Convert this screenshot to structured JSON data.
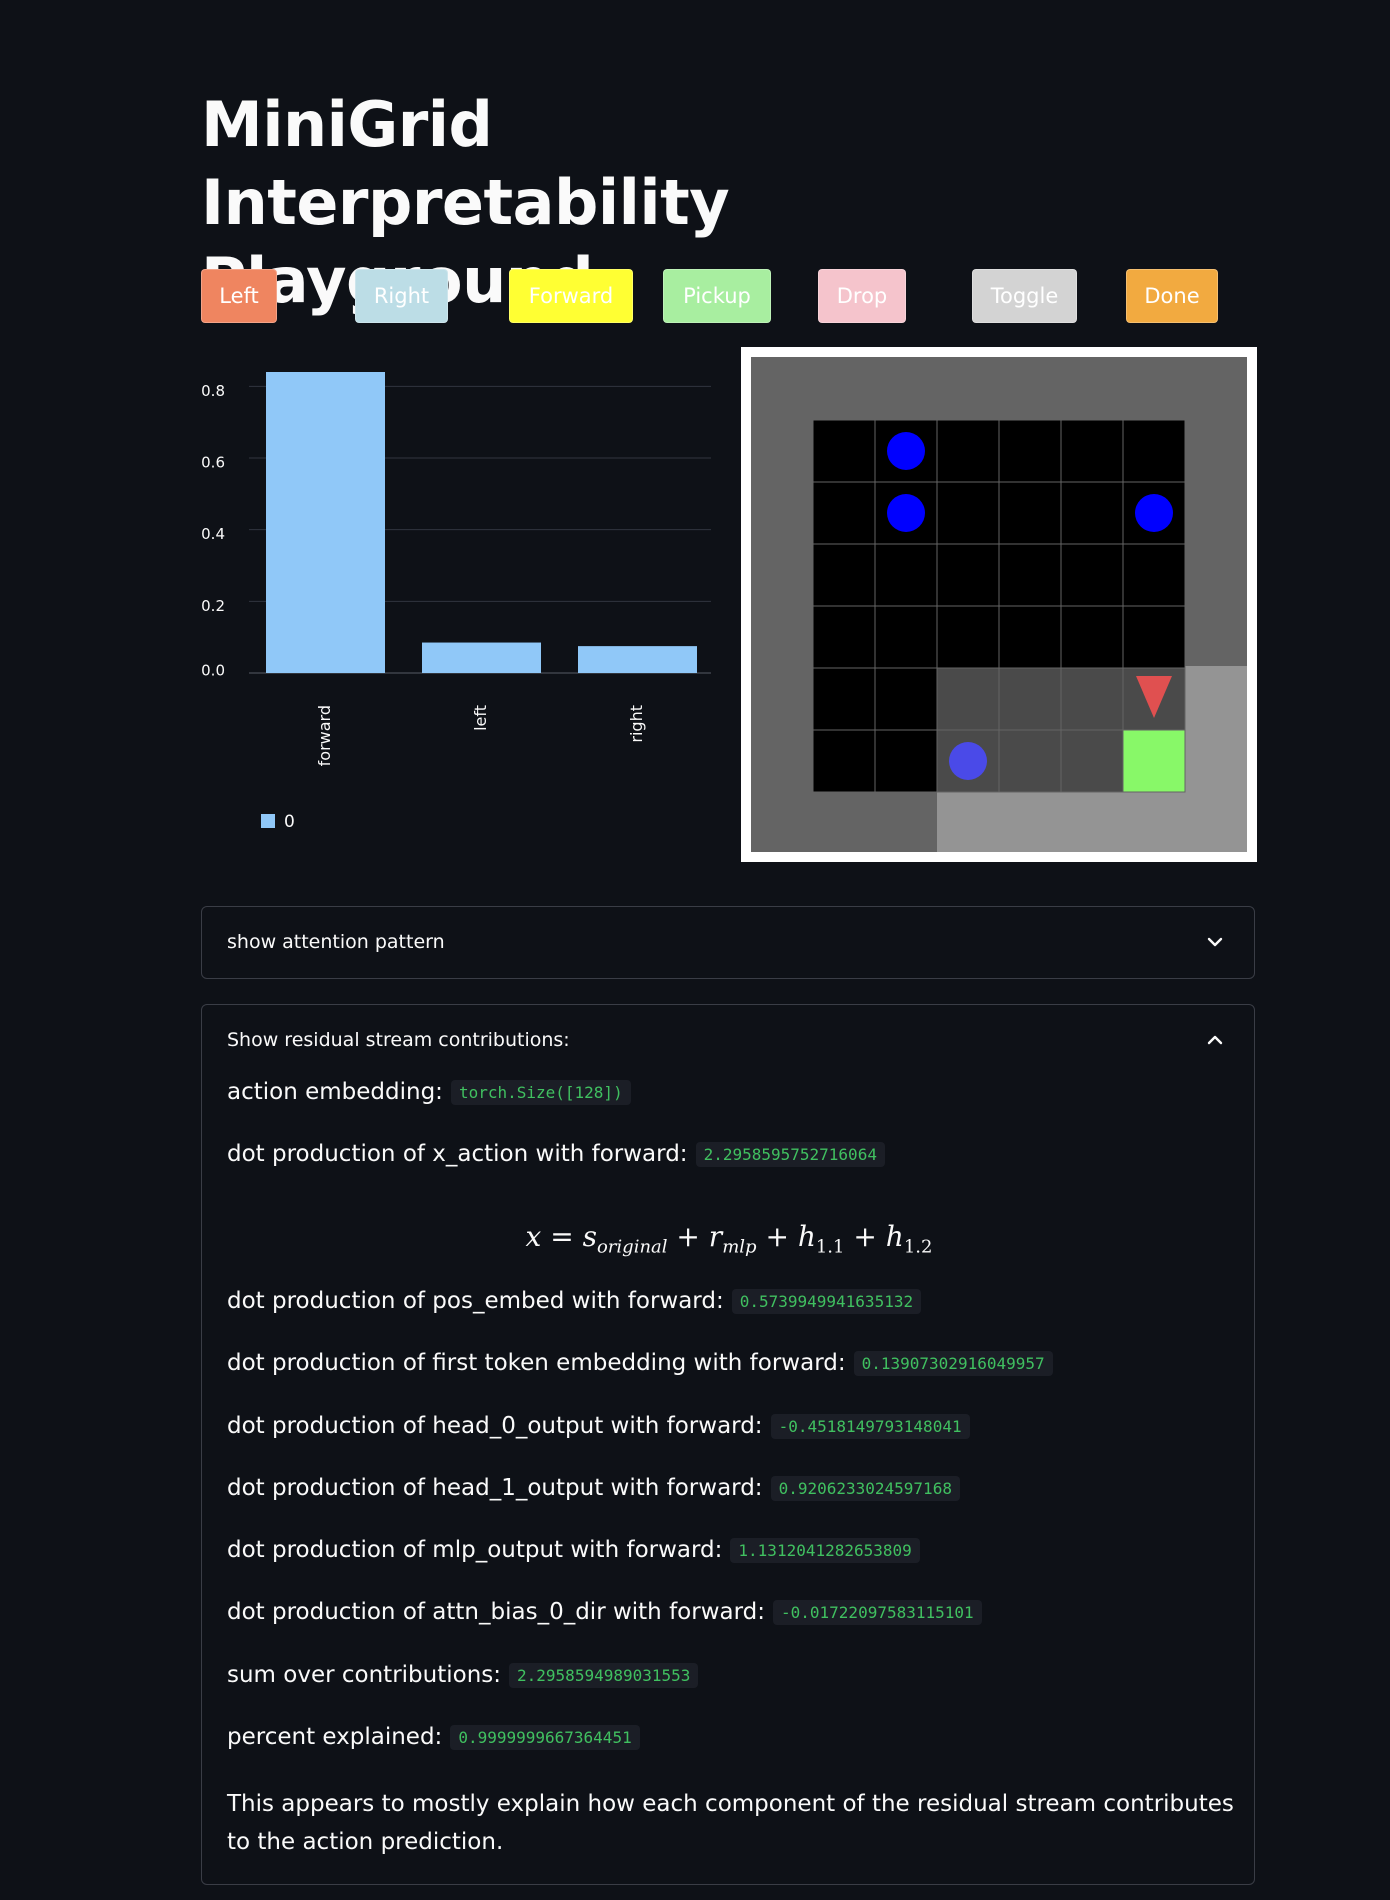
{
  "title": "MiniGrid Interpretability Playground",
  "action_buttons": [
    {
      "label": "Left",
      "color": "#ef8560"
    },
    {
      "label": "Right",
      "color": "#bcdde6"
    },
    {
      "label": "Forward",
      "color": "#ffff33"
    },
    {
      "label": "Pickup",
      "color": "#a8eea0"
    },
    {
      "label": "Drop",
      "color": "#f5c4cc"
    },
    {
      "label": "Toggle",
      "color": "#d3d3d3"
    },
    {
      "label": "Done",
      "color": "#f2aa40"
    }
  ],
  "chart_data": {
    "type": "bar",
    "categories": [
      "forward",
      "left",
      "right"
    ],
    "series": [
      {
        "name": "0",
        "values": [
          0.84,
          0.085,
          0.075
        ]
      }
    ],
    "yticks": [
      "0.0",
      "0.2",
      "0.4",
      "0.6",
      "0.8"
    ],
    "ylim": [
      0,
      0.84
    ],
    "legend_position": "bottom-left",
    "bar_color": "#90c8f8",
    "grid": true
  },
  "minigrid": {
    "cells": [
      [
        "black",
        "ball",
        "black",
        "black",
        "black",
        "black"
      ],
      [
        "black",
        "ball",
        "black",
        "black",
        "black",
        "ball"
      ],
      [
        "black",
        "black",
        "black",
        "black",
        "black",
        "black"
      ],
      [
        "black",
        "black",
        "black",
        "black",
        "black",
        "black"
      ],
      [
        "black",
        "black",
        "dim",
        "dim",
        "dim",
        "agent"
      ],
      [
        "black",
        "black",
        "ball-dim",
        "dim",
        "dim",
        "goal"
      ]
    ],
    "agent_color": "#e05050",
    "goal_color": "#88f868",
    "ball_color": "#0000ff"
  },
  "expanders": {
    "attention": {
      "label": "show attention pattern",
      "icon": "chevron-down-icon"
    },
    "residual": {
      "label": "Show residual stream contributions:",
      "icon": "chevron-up-icon"
    }
  },
  "residual": {
    "action_embedding": {
      "label": "action embedding:",
      "value": "torch.Size([128])"
    },
    "x_action": {
      "label": "dot production of x_action with forward:",
      "value": "2.2958595752716064"
    },
    "formula": {
      "x": "x",
      "eq": " = ",
      "s": "s",
      "s_sub": "original",
      "plus1": " + ",
      "r": "r",
      "r_sub": "mlp",
      "plus2": " + ",
      "h1": "h",
      "h1_sub": "1.1",
      "plus3": " + ",
      "h2": "h",
      "h2_sub": "1.2"
    },
    "pos_embed": {
      "label": "dot production of pos_embed with forward:",
      "value": "0.5739949941635132"
    },
    "first_token": {
      "label": "dot production of first token embedding with forward:",
      "value": "0.13907302916049957"
    },
    "head_0": {
      "label": "dot production of head_0_output with forward:",
      "value": "-0.4518149793148041"
    },
    "head_1": {
      "label": "dot production of head_1_output with forward:",
      "value": "0.9206233024597168"
    },
    "mlp": {
      "label": "dot production of mlp_output with forward:",
      "value": "1.1312041282653809"
    },
    "attn_bias": {
      "label": "dot production of attn_bias_0_dir with forward:",
      "value": "-0.01722097583115101"
    },
    "sum": {
      "label": "sum over contributions:",
      "value": "2.2958594989031553"
    },
    "percent": {
      "label": "percent explained:",
      "value": "0.9999999667364451"
    },
    "conclusion": "This appears to mostly explain how each component of the residual stream contributes to the action prediction."
  }
}
